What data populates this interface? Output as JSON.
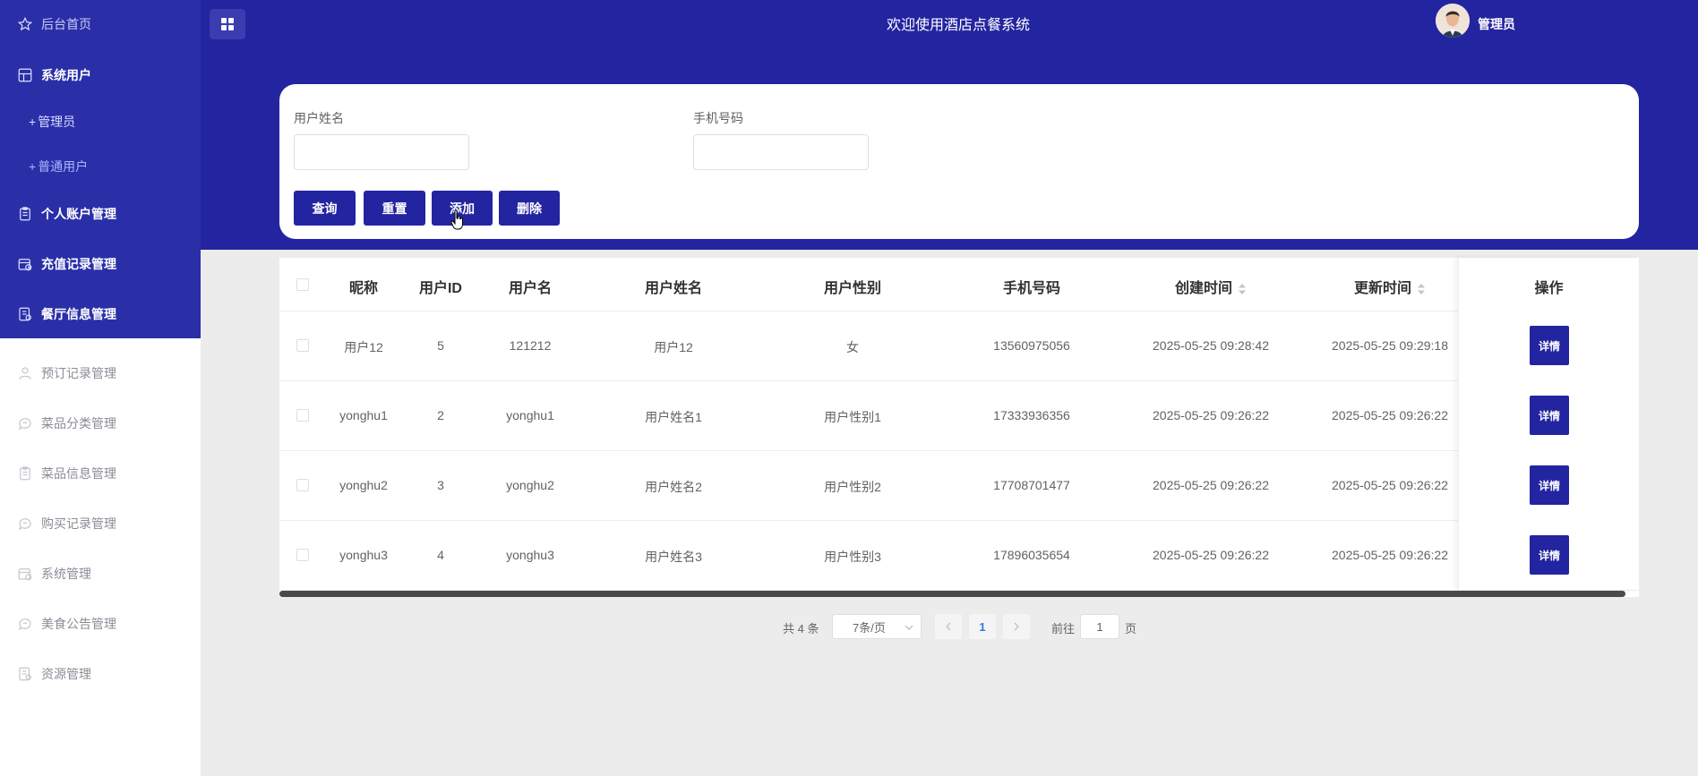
{
  "header": {
    "title": "欢迎使用酒店点餐系统",
    "user_name": "管理员"
  },
  "sidebar": {
    "items": [
      {
        "label": "后台首页",
        "icon": "star-icon"
      },
      {
        "label": "系统用户",
        "icon": "grid-icon"
      },
      {
        "label": "管理员"
      },
      {
        "label": "普通用户"
      },
      {
        "label": "个人账户管理",
        "icon": "clipboard-icon"
      },
      {
        "label": "充值记录管理",
        "icon": "calendar-icon"
      },
      {
        "label": "餐厅信息管理",
        "icon": "document-icon"
      },
      {
        "label": "预订记录管理",
        "icon": "user-icon"
      },
      {
        "label": "菜品分类管理",
        "icon": "chat-icon"
      },
      {
        "label": "菜品信息管理",
        "icon": "clipboard-icon"
      },
      {
        "label": "购买记录管理",
        "icon": "chat-icon"
      },
      {
        "label": "系统管理",
        "icon": "calendar-icon"
      },
      {
        "label": "美食公告管理",
        "icon": "chat-icon"
      },
      {
        "label": "资源管理",
        "icon": "document-icon"
      }
    ],
    "plus": "+"
  },
  "search": {
    "name_label": "用户姓名",
    "phone_label": "手机号码",
    "name_value": "",
    "phone_value": "",
    "buttons": {
      "query": "查询",
      "reset": "重置",
      "add": "添加",
      "delete": "删除"
    }
  },
  "table": {
    "columns": [
      "昵称",
      "用户ID",
      "用户名",
      "用户姓名",
      "用户性别",
      "手机号码",
      "创建时间",
      "更新时间",
      "操作"
    ],
    "rows": [
      {
        "nick": "用户12",
        "id": "5",
        "username": "121212",
        "realname": "用户12",
        "gender": "女",
        "phone": "13560975056",
        "created": "2025-05-25 09:28:42",
        "updated": "2025-05-25 09:29:18",
        "action": "详情"
      },
      {
        "nick": "yonghu1",
        "id": "2",
        "username": "yonghu1",
        "realname": "用户姓名1",
        "gender": "用户性别1",
        "phone": "17333936356",
        "created": "2025-05-25 09:26:22",
        "updated": "2025-05-25 09:26:22",
        "action": "详情"
      },
      {
        "nick": "yonghu2",
        "id": "3",
        "username": "yonghu2",
        "realname": "用户姓名2",
        "gender": "用户性别2",
        "phone": "17708701477",
        "created": "2025-05-25 09:26:22",
        "updated": "2025-05-25 09:26:22",
        "action": "详情"
      },
      {
        "nick": "yonghu3",
        "id": "4",
        "username": "yonghu3",
        "realname": "用户姓名3",
        "gender": "用户性别3",
        "phone": "17896035654",
        "created": "2025-05-25 09:26:22",
        "updated": "2025-05-25 09:26:22",
        "action": "详情"
      }
    ]
  },
  "pagination": {
    "total": "共 4 条",
    "page_size": "7条/页",
    "current_page": "1",
    "goto_prefix": "前往",
    "goto_value": "1",
    "goto_suffix": "页"
  },
  "colors": {
    "primary": "#2324a0",
    "sidebar": "#2a2fa8"
  }
}
